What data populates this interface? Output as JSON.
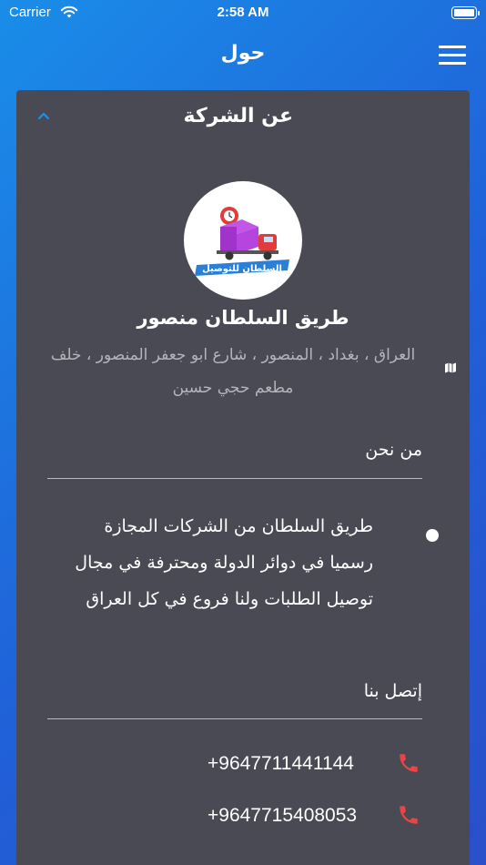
{
  "status_bar": {
    "carrier": "Carrier",
    "time": "2:58 AM"
  },
  "nav": {
    "title": "حول",
    "menu_icon": "hamburger-menu-icon"
  },
  "card": {
    "header_title": "عن الشركة",
    "collapse_icon": "chevron-up-icon",
    "company_name": "طريق السلطان منصور",
    "address": "العراق ، بغداد ، المنصور ، شارع ابو جعفر المنصور ، خلف مطعم حجي حسين",
    "logo_text": "السلطان للتوصيل",
    "about_title": "من نحن",
    "about_text": "طريق السلطان من الشركات المجازة رسميا في دوائر الدولة ومحترفة في مجال توصيل الطلبات ولنا فروع في كل العراق",
    "contact_title": "إتصل بنا",
    "phones": [
      "+9647711441144",
      "+9647715408053"
    ]
  },
  "colors": {
    "accent": "#1f8ee8",
    "card_bg": "#4a4a55",
    "phone_icon": "#e84545"
  }
}
